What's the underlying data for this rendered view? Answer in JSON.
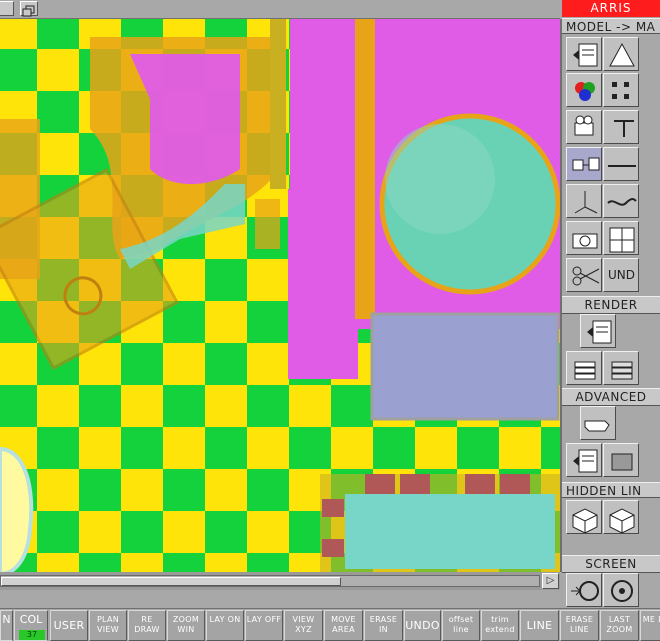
{
  "app": {
    "title": "ARRIS",
    "colors": {
      "accent": "#ff1c1c",
      "panel": "#a8a8a8",
      "col_value_bg": "#28c828"
    }
  },
  "panel": {
    "sections": {
      "model_map": "MODEL -> MA",
      "render": "RENDER",
      "advanced": "ADVANCED",
      "hidden_line": "HIDDEN LIN",
      "screen": "SCREEN"
    },
    "undo_label": "UND",
    "icons": [
      "panel-view-icon",
      "triangle-icon",
      "color-wheel-icon",
      "grid-dots-icon",
      "camera-video-icon",
      "stand-icon",
      "move-cube-icon",
      "line-icon",
      "axes-xyz-icon",
      "tilde-icon",
      "camera-icon",
      "window-icon",
      "scissors-icon",
      "render-panel-icon",
      "stack-icon",
      "stack-icon-2",
      "hand-pointer-icon",
      "panel-shade-icon",
      "shaded-stack-icon",
      "box-wireframe-icon",
      "box-wireframe-icon-2",
      "arrow-circle-icon",
      "circle-icon"
    ]
  },
  "status": {
    "n_label": "N",
    "col_label": "COL",
    "col_value": "37"
  },
  "toolbar": {
    "buttons": [
      {
        "id": "user",
        "label": "USER"
      },
      {
        "id": "plan-view",
        "label": "PLAN VIEW"
      },
      {
        "id": "redraw",
        "label": "RE DRAW"
      },
      {
        "id": "zoom-win",
        "label": "ZOOM WIN"
      },
      {
        "id": "lay-on",
        "label": "LAY ON"
      },
      {
        "id": "lay-off",
        "label": "LAY OFF"
      },
      {
        "id": "view-xyz",
        "label": "VIEW XYZ"
      },
      {
        "id": "move-area",
        "label": "MOVE AREA"
      },
      {
        "id": "erase-in",
        "label": "ERASE IN"
      },
      {
        "id": "undo",
        "label": "UNDO"
      },
      {
        "id": "offset-line",
        "label": "offset line"
      },
      {
        "id": "trim-extend",
        "label": "trim extend"
      },
      {
        "id": "line",
        "label": "LINE"
      },
      {
        "id": "erase-line",
        "label": "ERASE LINE"
      },
      {
        "id": "last-zoom",
        "label": "LAST ZOOM"
      },
      {
        "id": "me-di",
        "label": "ME DI"
      }
    ]
  },
  "canvas": {
    "floor_colors": [
      "#ffe40a",
      "#14d23c"
    ],
    "object_colors": {
      "counter": "#e8a418",
      "wall": "#e05ce6",
      "tub": "#6ad2b4",
      "vanity": "#9aa0d0",
      "fixture": "#78d6c8"
    }
  },
  "scroll": {
    "arrow": "▷"
  }
}
